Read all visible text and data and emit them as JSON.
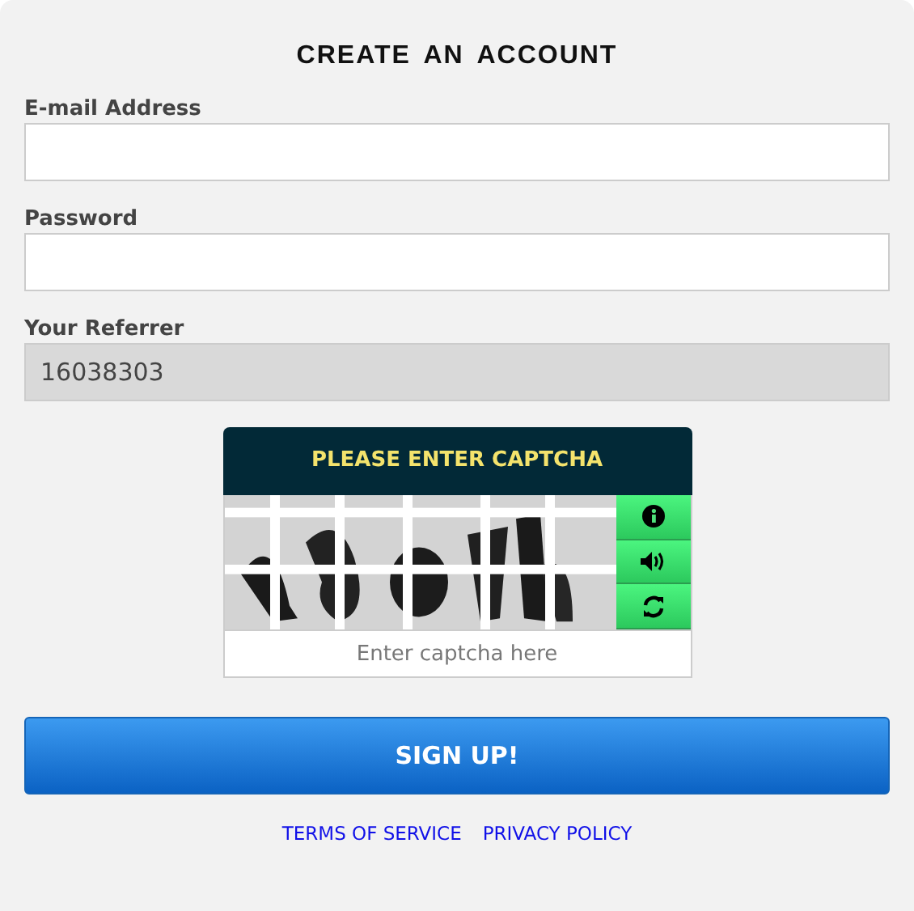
{
  "title": "CREATE AN ACCOUNT",
  "fields": [
    {
      "label": "E-mail Address",
      "disabled": false
    },
    {
      "label": "Password",
      "disabled": false
    },
    {
      "label": "Your Referrer",
      "value": "16038303",
      "disabled": true
    }
  ],
  "captcha": {
    "heading": "PLEASE ENTER CAPTCHA",
    "buttons": [
      {
        "kind": "info"
      },
      {
        "kind": "audio"
      },
      {
        "kind": "refresh"
      }
    ],
    "placeholder": "Enter captcha here"
  },
  "submit": "SIGN UP!",
  "links": [
    "TERMS OF SERVICE",
    "PRIVACY POLICY"
  ]
}
